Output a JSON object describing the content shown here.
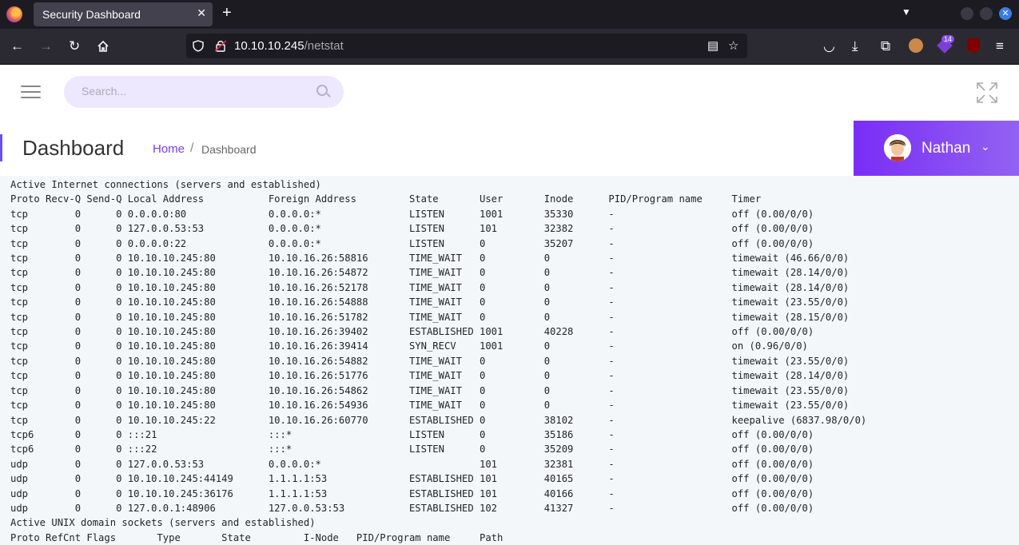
{
  "browser": {
    "tab_title": "Security Dashboard",
    "url_host": "10.10.10.245",
    "url_path": "/netstat",
    "extension_badge": "14"
  },
  "header": {
    "search_placeholder": "Search..."
  },
  "page": {
    "title": "Dashboard",
    "breadcrumb_home": "Home",
    "breadcrumb_sep": "/",
    "breadcrumb_current": "Dashboard"
  },
  "user": {
    "name": "Nathan"
  },
  "netstat": {
    "inet_heading": "Active Internet connections (servers and established)",
    "inet_columns": "Proto Recv-Q Send-Q Local Address           Foreign Address         State       User       Inode      PID/Program name     Timer",
    "inet_rows": [
      "tcp        0      0 0.0.0.0:80              0.0.0.0:*               LISTEN      1001       35330      -                    off (0.00/0/0)",
      "tcp        0      0 127.0.0.53:53           0.0.0.0:*               LISTEN      101        32382      -                    off (0.00/0/0)",
      "tcp        0      0 0.0.0.0:22              0.0.0.0:*               LISTEN      0          35207      -                    off (0.00/0/0)",
      "tcp        0      0 10.10.10.245:80         10.10.16.26:58816       TIME_WAIT   0          0          -                    timewait (46.66/0/0)",
      "tcp        0      0 10.10.10.245:80         10.10.16.26:54872       TIME_WAIT   0          0          -                    timewait (28.14/0/0)",
      "tcp        0      0 10.10.10.245:80         10.10.16.26:52178       TIME_WAIT   0          0          -                    timewait (28.14/0/0)",
      "tcp        0      0 10.10.10.245:80         10.10.16.26:54888       TIME_WAIT   0          0          -                    timewait (23.55/0/0)",
      "tcp        0      0 10.10.10.245:80         10.10.16.26:51782       TIME_WAIT   0          0          -                    timewait (28.15/0/0)",
      "tcp        0      0 10.10.10.245:80         10.10.16.26:39402       ESTABLISHED 1001       40228      -                    off (0.00/0/0)",
      "tcp        0      0 10.10.10.245:80         10.10.16.26:39414       SYN_RECV    1001       0          -                    on (0.96/0/0)",
      "tcp        0      0 10.10.10.245:80         10.10.16.26:54882       TIME_WAIT   0          0          -                    timewait (23.55/0/0)",
      "tcp        0      0 10.10.10.245:80         10.10.16.26:51776       TIME_WAIT   0          0          -                    timewait (28.14/0/0)",
      "tcp        0      0 10.10.10.245:80         10.10.16.26:54862       TIME_WAIT   0          0          -                    timewait (23.55/0/0)",
      "tcp        0      0 10.10.10.245:80         10.10.16.26:54936       TIME_WAIT   0          0          -                    timewait (23.55/0/0)",
      "tcp        0      0 10.10.10.245:22         10.10.16.26:60770       ESTABLISHED 0          38102      -                    keepalive (6837.98/0/0)",
      "tcp6       0      0 :::21                   :::*                    LISTEN      0          35186      -                    off (0.00/0/0)",
      "tcp6       0      0 :::22                   :::*                    LISTEN      0          35209      -                    off (0.00/0/0)",
      "udp        0      0 127.0.0.53:53           0.0.0.0:*                           101        32381      -                    off (0.00/0/0)",
      "udp        0      0 10.10.10.245:44149      1.1.1.1:53              ESTABLISHED 101        40165      -                    off (0.00/0/0)",
      "udp        0      0 10.10.10.245:36176      1.1.1.1:53              ESTABLISHED 101        40166      -                    off (0.00/0/0)",
      "udp        0      0 127.0.0.1:48906         127.0.0.53:53           ESTABLISHED 102        41327      -                    off (0.00/0/0)"
    ],
    "unix_heading": "Active UNIX domain sockets (servers and established)",
    "unix_columns": "Proto RefCnt Flags       Type       State         I-Node   PID/Program name     Path"
  }
}
